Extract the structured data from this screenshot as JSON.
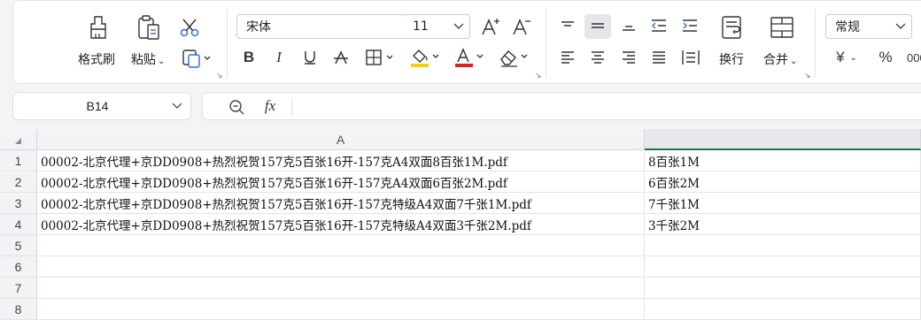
{
  "ribbon": {
    "format_painter": "格式刷",
    "paste": "粘贴",
    "font_name": "宋体",
    "font_size": "11",
    "wrap_text": "换行",
    "merge": "合并",
    "number_format": "常规",
    "currency_symbol": "¥",
    "percent_symbol": "%",
    "font_color": "#e02020",
    "highlight_color": "#f5d000"
  },
  "formula": {
    "name_box": "B14",
    "fx": "fx",
    "value": ""
  },
  "sheet": {
    "columns": [
      "A",
      ""
    ],
    "rows": [
      {
        "num": "1",
        "a": "00002-北京代理+京DD0908+热烈祝贺157克5百张16开-157克A4双面8百张1M.pdf",
        "b": "8百张1M"
      },
      {
        "num": "2",
        "a": "00002-北京代理+京DD0908+热烈祝贺157克5百张16开-157克A4双面6百张2M.pdf",
        "b": "6百张2M"
      },
      {
        "num": "3",
        "a": "00002-北京代理+京DD0908+热烈祝贺157克5百张16开-157克特级A4双面7千张1M.pdf",
        "b": "7千张1M"
      },
      {
        "num": "4",
        "a": "00002-北京代理+京DD0908+热烈祝贺157克5百张16开-157克特级A4双面3千张2M.pdf",
        "b": "3千张2M"
      },
      {
        "num": "5",
        "a": "",
        "b": ""
      },
      {
        "num": "6",
        "a": "",
        "b": ""
      },
      {
        "num": "7",
        "a": "",
        "b": ""
      },
      {
        "num": "8",
        "a": "",
        "b": ""
      }
    ]
  }
}
